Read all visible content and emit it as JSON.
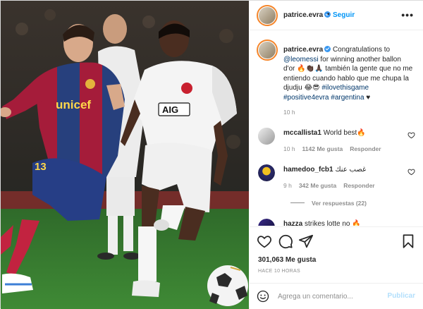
{
  "post": {
    "author": "patrice.evra",
    "follow_label": "Seguir",
    "more_label": "•••",
    "caption": {
      "username": "patrice.evra",
      "text_1": "Congratulations to ",
      "mention": "@leomessi",
      "text_2": " for winning another ballon d'or 🔥👏🏿🙏🏿 también la gente que no me entiendo cuando hablo que me chupa la djudju 😂😎 ",
      "hashtag_1": "#ilovethisgame",
      "hashtag_2": "#positive4evra",
      "hashtag_3": "#argentina",
      "text_3": " ♥",
      "time": "10 h"
    },
    "comments": [
      {
        "username": "mccallista1",
        "text": "World best🔥",
        "time": "10 h",
        "likes": "1142 Me gusta",
        "reply_label": "Responder"
      },
      {
        "username": "hamedoo_fcb1",
        "text": "غصب عنك",
        "time": "9 h",
        "likes": "342 Me gusta",
        "reply_label": "Responder",
        "replies_label": "Ver respuestas (22)"
      },
      {
        "username": "hazza",
        "text": "strikes lotte no 🔥"
      }
    ],
    "likes_label": "301,063 Me gusta",
    "posted_label": "HACE 10 HORAS",
    "add_comment_placeholder": "Agrega un comentario...",
    "publish_label": "Publicar"
  },
  "photo": {
    "barca_sponsor": "unicef",
    "barca_number": "13",
    "united_sponsor": "AIG"
  },
  "icons": {
    "like": "heart-icon",
    "comment": "comment-bubble-icon",
    "share": "paper-plane-icon",
    "save": "bookmark-icon",
    "emoji": "smiley-icon"
  },
  "colors": {
    "link_blue": "#0095f6",
    "tag_navy": "#00376b",
    "muted": "#8e8e8e",
    "publish_disabled": "#b2dffc"
  }
}
